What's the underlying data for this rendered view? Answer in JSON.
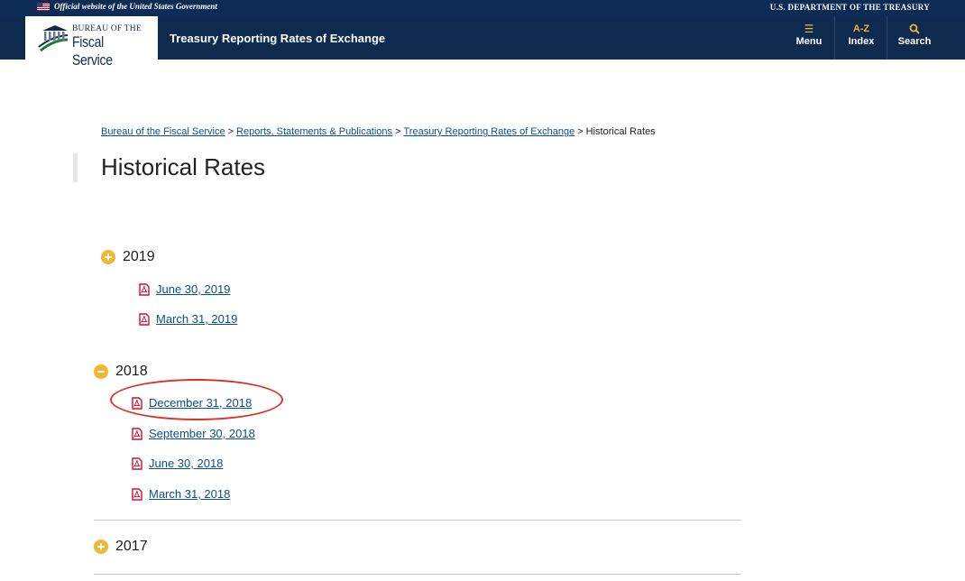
{
  "gov_banner": {
    "official_text": "Official website of the United States Government",
    "department_text": "U.S. DEPARTMENT OF THE TREASURY"
  },
  "header": {
    "logo_line1": "BUREAU OF THE",
    "logo_line2": "Fiscal Service",
    "site_title": "Treasury Reporting Rates of Exchange",
    "nav": [
      {
        "label": "Menu",
        "icon": "menu-icon",
        "glyph": "☰"
      },
      {
        "label": "Index",
        "icon": "az-icon",
        "glyph": "A-Z"
      },
      {
        "label": "Search",
        "icon": "search-icon",
        "glyph": "⚲"
      }
    ]
  },
  "breadcrumb": {
    "items": [
      "Bureau of the Fiscal Service",
      "Reports, Statements & Publications",
      "Treasury Reporting Rates of Exchange"
    ],
    "current": "Historical Rates",
    "separator": ">"
  },
  "page": {
    "title": "Historical Rates"
  },
  "years": [
    {
      "year": "2019",
      "state": "expand",
      "links": [
        "June 30, 2019",
        "March 31, 2019"
      ]
    },
    {
      "year": "2018",
      "state": "collapse",
      "links": [
        "December 31, 2018",
        "September 30, 2018",
        "June 30, 2018",
        "March 31, 2018"
      ]
    },
    {
      "year": "2017",
      "state": "expand",
      "links": []
    }
  ],
  "colors": {
    "navy": "#0e2a4f",
    "banner": "#0d2c55",
    "accent_gold": "#f2b632",
    "link_blue": "#0b4f8a",
    "pdf_red": "#c8102e",
    "annotation_red": "#d8312a"
  }
}
